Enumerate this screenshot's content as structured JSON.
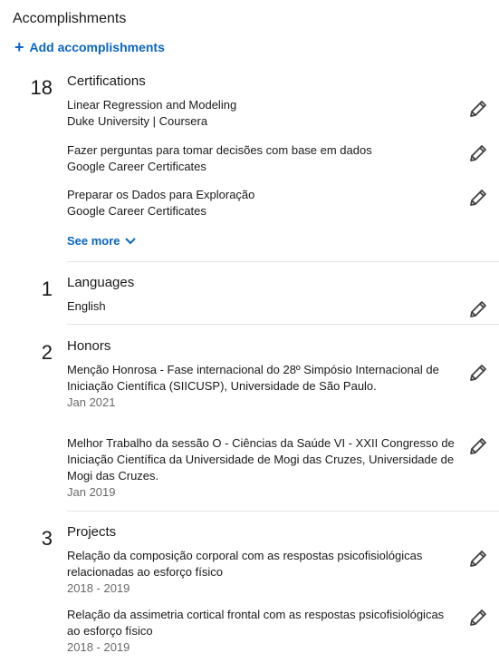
{
  "header": {
    "title": "Accomplishments",
    "add_label": "Add accomplishments",
    "add_icon": "plus-icon"
  },
  "colors": {
    "accent": "#0a66c2",
    "text": "#191919",
    "muted": "#666666"
  },
  "certifications": {
    "count": "18",
    "title": "Certifications",
    "items": [
      {
        "name": "Linear Regression and Modeling",
        "issuer": "Duke University | Coursera"
      },
      {
        "name": "Fazer perguntas para tomar decisões com base em dados",
        "issuer": "Google Career Certificates"
      },
      {
        "name": "Preparar os Dados para Exploração",
        "issuer": "Google Career Certificates"
      }
    ],
    "see_more": "See more"
  },
  "languages": {
    "count": "1",
    "title": "Languages",
    "items": [
      {
        "name": "English"
      }
    ]
  },
  "honors": {
    "count": "2",
    "title": "Honors",
    "items": [
      {
        "name": "Menção Honrosa - Fase internacional do 28º Simpósio Internacional de Iniciação Científica (SIICUSP), Universidade de São Paulo.",
        "date": "Jan 2021"
      },
      {
        "name": "Melhor Trabalho da sessão O - Ciências da Saúde VI - XXII Congresso de Iniciação Científica da Universidade de Mogi das Cruzes, Universidade de Mogi das Cruzes.",
        "date": "Jan 2019"
      }
    ]
  },
  "projects": {
    "count": "3",
    "title": "Projects",
    "items": [
      {
        "name": "Relação da composição corporal com as respostas psicofisiológicas relacionadas ao esforço físico",
        "date": "2018 - 2019"
      },
      {
        "name": "Relação da assimetria cortical frontal com as respostas psicofisiológicas ao esforço físico",
        "date": "2018 - 2019"
      }
    ]
  }
}
